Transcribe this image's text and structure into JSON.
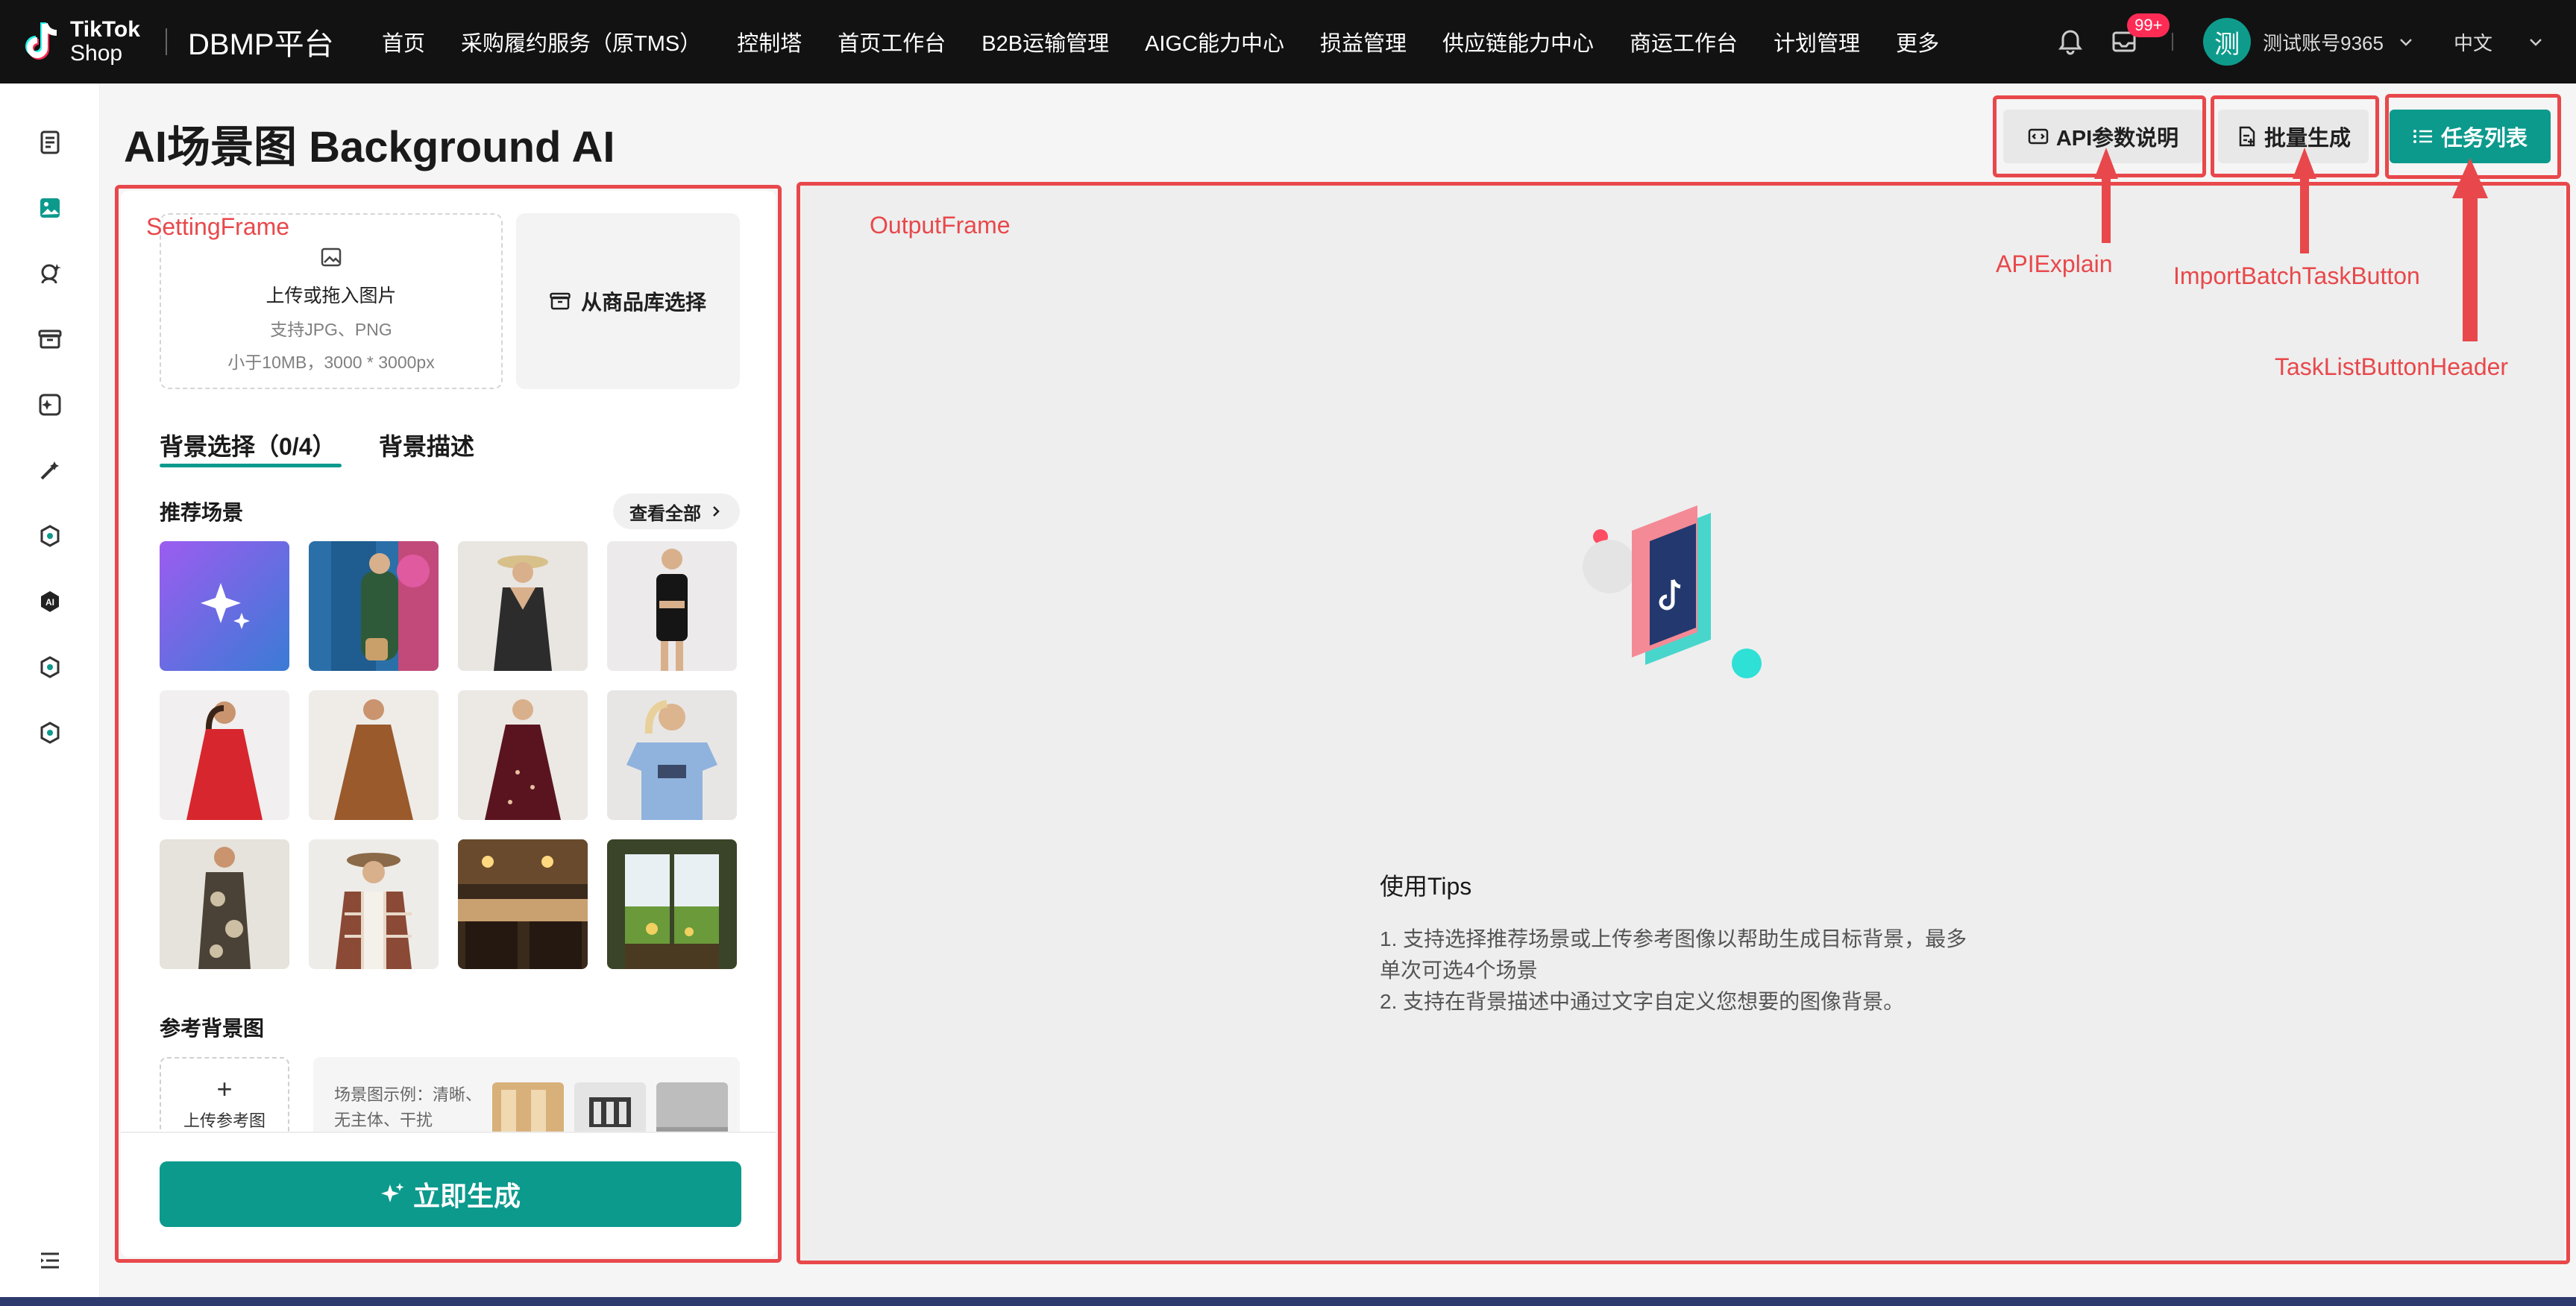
{
  "topbar": {
    "logo_line1": "TikTok",
    "logo_line2": "Shop",
    "platform": "DBMP平台",
    "nav": [
      "首页",
      "采购履约服务（原TMS）",
      "控制塔",
      "首页工作台",
      "B2B运输管理",
      "AIGC能力中心",
      "损益管理",
      "供应链能力中心",
      "商运工作台",
      "计划管理",
      "更多"
    ],
    "badge": "99+",
    "avatar": "测",
    "account": "测试账号9365",
    "language": "中文"
  },
  "page": {
    "title": "AI场景图 Background AI",
    "btn_api": "API参数说明",
    "btn_batch": "批量生成",
    "btn_tasks": "任务列表"
  },
  "annotations": {
    "setting_frame": "SettingFrame",
    "output_frame": "OutputFrame",
    "api_explain": "APIExplain",
    "import_batch": "ImportBatchTaskButton",
    "task_list": "TaskListButtonHeader"
  },
  "setting": {
    "upload_main": "上传或拖入图片",
    "upload_format": "支持JPG、PNG",
    "upload_limit": "小于10MB，3000 * 3000px",
    "pick_from_library": "从商品库选择",
    "tab_bg_select": "背景选择（0/4）",
    "tab_bg_desc": "背景描述",
    "recommended": "推荐场景",
    "view_all": "查看全部",
    "ref_bg": "参考背景图",
    "ref_upload": "上传参考图",
    "ref_example": "场景图示例：清晰、无主体、干扰",
    "generate": "立即生成"
  },
  "output": {
    "tips_title": "使用Tips",
    "tip1_a": "1. 支持选择推荐场景或上传参考图像以帮助生成目标背景，最多",
    "tip1_b": "单次可选4个场景",
    "tip2": "2. 支持在背景描述中通过文字自定义您想要的图像背景。"
  },
  "colors": {
    "accent": "#0c9a8d",
    "annotation": "#e8484b",
    "topbar": "#121212"
  }
}
